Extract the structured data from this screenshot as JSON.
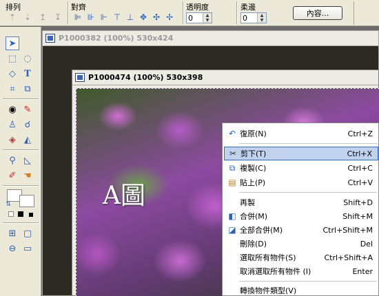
{
  "toolbar": {
    "arrange": {
      "label": "排列",
      "icons": [
        "bring-to-front-icon",
        "send-to-back-icon",
        "bring-forward-icon",
        "send-backward-icon"
      ]
    },
    "align": {
      "label": "對齊",
      "icons": [
        "align-left-icon",
        "align-center-icon",
        "align-right-icon",
        "align-top-icon",
        "align-middle-icon",
        "align-bottom-icon",
        "distribute-horizontal-icon",
        "distribute-vertical-icon"
      ]
    },
    "opacity": {
      "label": "透明度",
      "value": "0"
    },
    "feather": {
      "label": "柔邊",
      "value": "0"
    },
    "properties_label": "內容..."
  },
  "tools": [
    "pointer",
    "select",
    "lasso",
    "shape",
    "text",
    "crop",
    "transform",
    "eye",
    "paint-brush",
    "clone-stamp",
    "dodge",
    "eraser",
    "fill",
    "zoom",
    "gradient",
    "pen",
    "hand",
    "foreground-color",
    "background-color",
    "swap-colors",
    "default-colors",
    "view-grid",
    "view-frame",
    "view-link",
    "view-ruler"
  ],
  "windows": {
    "back_title": "P1000382 (100%) 530x424",
    "front_title": "P1000474 (100%) 530x398"
  },
  "canvas": {
    "overlay_text": "A圖",
    "watermark": "#938541"
  },
  "context_menu": {
    "items": [
      {
        "label": "復原(N)",
        "shortcut": "Ctrl+Z",
        "icon": "undo-icon"
      },
      {
        "label": "剪下(T)",
        "shortcut": "Ctrl+X",
        "icon": "scissors-icon",
        "highlighted": true
      },
      {
        "label": "複製(C)",
        "shortcut": "Ctrl+C",
        "icon": "copy-icon"
      },
      {
        "label": "貼上(P)",
        "shortcut": "Ctrl+V",
        "icon": "paste-icon"
      },
      {
        "label": "再製",
        "shortcut": "Shift+D",
        "icon": ""
      },
      {
        "label": "合併(M)",
        "shortcut": "Shift+M",
        "icon": "merge-icon"
      },
      {
        "label": "全部合併(M)",
        "shortcut": "Ctrl+Shift+M",
        "icon": "merge-all-icon"
      },
      {
        "label": "刪除(D)",
        "shortcut": "Del",
        "icon": ""
      },
      {
        "label": "選取所有物件(S)",
        "shortcut": "Ctrl+Shift+A",
        "icon": ""
      },
      {
        "label": "取消選取所有物件 (I)",
        "shortcut": "Enter",
        "icon": ""
      },
      {
        "label": "轉換物件類型(V)",
        "shortcut": "",
        "icon": ""
      }
    ]
  },
  "colors": {
    "menu_highlight": "#c1d2ee",
    "menu_highlight_border": "#316ac5",
    "toolbar_bg": "#ece9d8"
  }
}
